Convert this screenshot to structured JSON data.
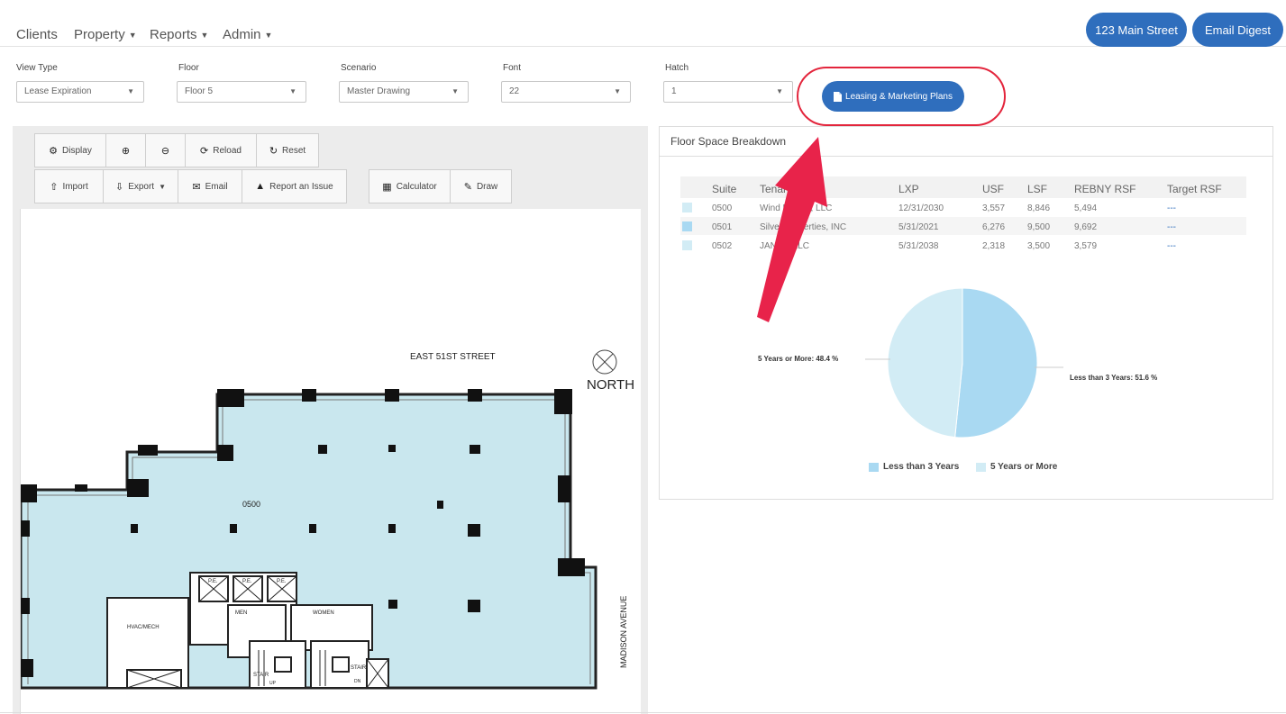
{
  "nav": {
    "clients": "Clients",
    "property": "Property",
    "reports": "Reports",
    "admin": "Admin",
    "address_button": "123 Main Street",
    "email_digest_button": "Email Digest"
  },
  "filters": {
    "view_type": {
      "label": "View Type",
      "value": "Lease Expiration"
    },
    "floor": {
      "label": "Floor",
      "value": "Floor 5"
    },
    "scenario": {
      "label": "Scenario",
      "value": "Master Drawing"
    },
    "font": {
      "label": "Font",
      "value": "22"
    },
    "hatch": {
      "label": "Hatch",
      "value": "1"
    },
    "leasing_button": "Leasing & Marketing Plans"
  },
  "toolbar": {
    "display": "Display",
    "reload": "Reload",
    "reset": "Reset",
    "import": "Import",
    "export": "Export",
    "email": "Email",
    "report_issue": "Report an Issue",
    "calculator": "Calculator",
    "draw": "Draw"
  },
  "floorplan": {
    "street_top": "EAST 51ST STREET",
    "street_right": "MADISON AVENUE",
    "north": "NORTH",
    "suite_label": "0500",
    "rooms": [
      "P.E.",
      "P.E.",
      "P.E.",
      "MEN",
      "WOMEN",
      "HVAC/MECH",
      "STAIR",
      "STAIR",
      "UP",
      "DN"
    ],
    "fill_color": "#c9e7ee"
  },
  "breakdown": {
    "title": "Floor Space Breakdown",
    "columns": [
      "Suite",
      "Tenant",
      "LXP",
      "USF",
      "LSF",
      "REBNY RSF",
      "Target RSF"
    ],
    "rows": [
      {
        "suite": "0500",
        "tenant": "Wind Energy, LLC",
        "lxp": "12/31/2030",
        "usf": "3,557",
        "lsf": "8,846",
        "rebny": "5,494",
        "target": "---",
        "color": "#d2ecf5"
      },
      {
        "suite": "0501",
        "tenant": "Silver Properties, INC",
        "lxp": "5/31/2021",
        "usf": "6,276",
        "lsf": "9,500",
        "rebny": "9,692",
        "target": "---",
        "color": "#a9d9f2"
      },
      {
        "suite": "0502",
        "tenant": "JANCO LLC",
        "lxp": "5/31/2038",
        "usf": "2,318",
        "lsf": "3,500",
        "rebny": "3,579",
        "target": "---",
        "color": "#d2ecf5"
      }
    ]
  },
  "chart_data": {
    "type": "pie",
    "slices": [
      {
        "name": "Less than 3 Years",
        "value": 51.6,
        "label": "Less than 3 Years: 51.6 %",
        "color": "#a9d9f2"
      },
      {
        "name": "5 Years or More",
        "value": 48.4,
        "label": "5 Years or More: 48.4 %",
        "color": "#d2ecf5"
      }
    ],
    "legend": "bottom"
  },
  "colors": {
    "accent": "#2f6ebd",
    "highlight": "#e3253c"
  }
}
